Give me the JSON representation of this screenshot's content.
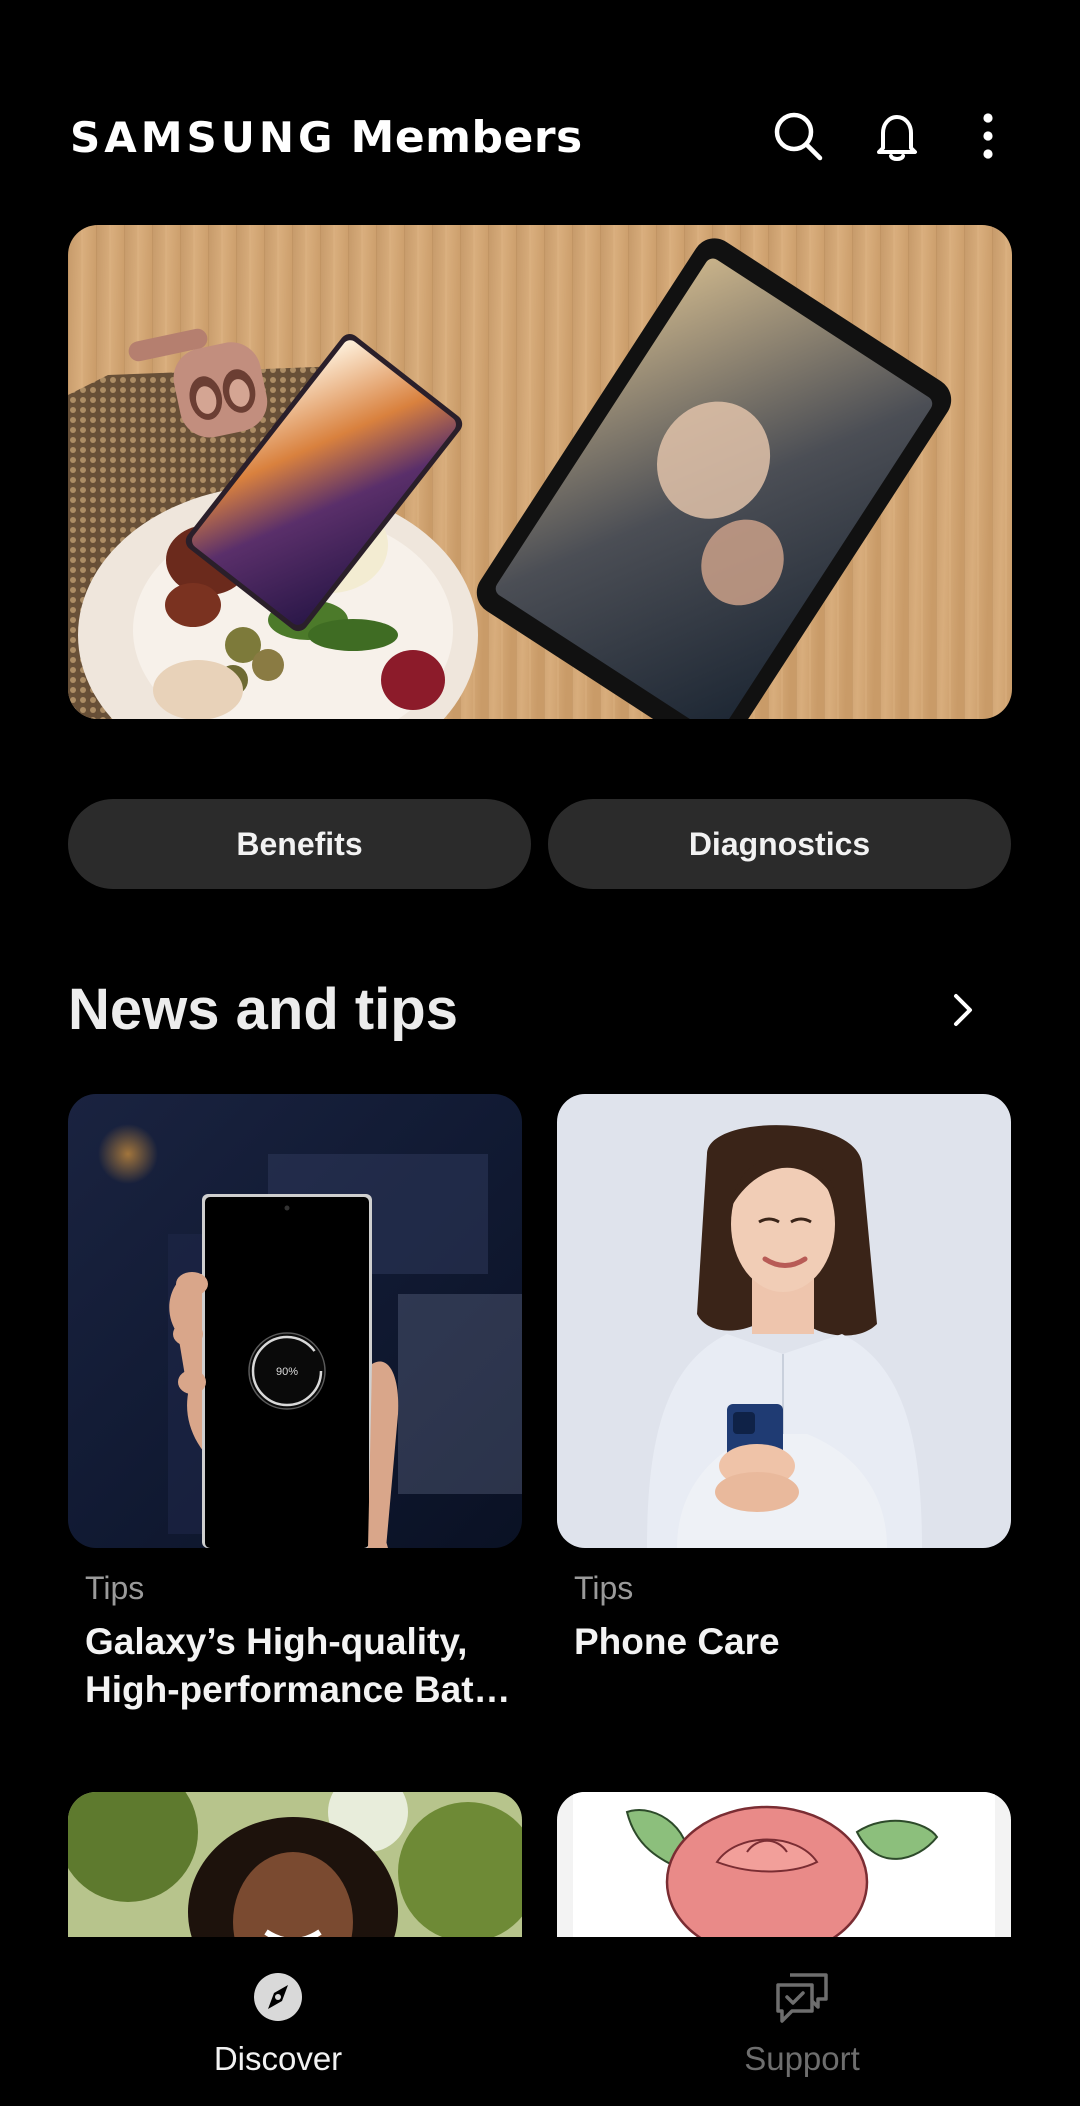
{
  "header": {
    "brand_wordmark": "SAMSUNG",
    "brand_product": "Members",
    "icons": [
      "search-icon",
      "bell-icon",
      "more-vert-icon"
    ]
  },
  "quick_actions": {
    "benefits_label": "Benefits",
    "diagnostics_label": "Diagnostics"
  },
  "news": {
    "title": "News and tips",
    "cards": [
      {
        "category": "Tips",
        "title": "Galaxy’s High-quality, High-performance Bat…",
        "battery_level": "90%"
      },
      {
        "category": "Tips",
        "title": "Phone Care"
      }
    ]
  },
  "bottom_nav": {
    "items": [
      {
        "label": "Discover",
        "icon": "compass-icon",
        "active": true
      },
      {
        "label": "Support",
        "icon": "chat-support-icon",
        "active": false
      }
    ]
  },
  "colors": {
    "background": "#000000",
    "pill": "#2b2b2b",
    "text_primary": "#ffffff",
    "text_secondary": "#9a9a9a",
    "nav_inactive": "#6e6e6e"
  }
}
